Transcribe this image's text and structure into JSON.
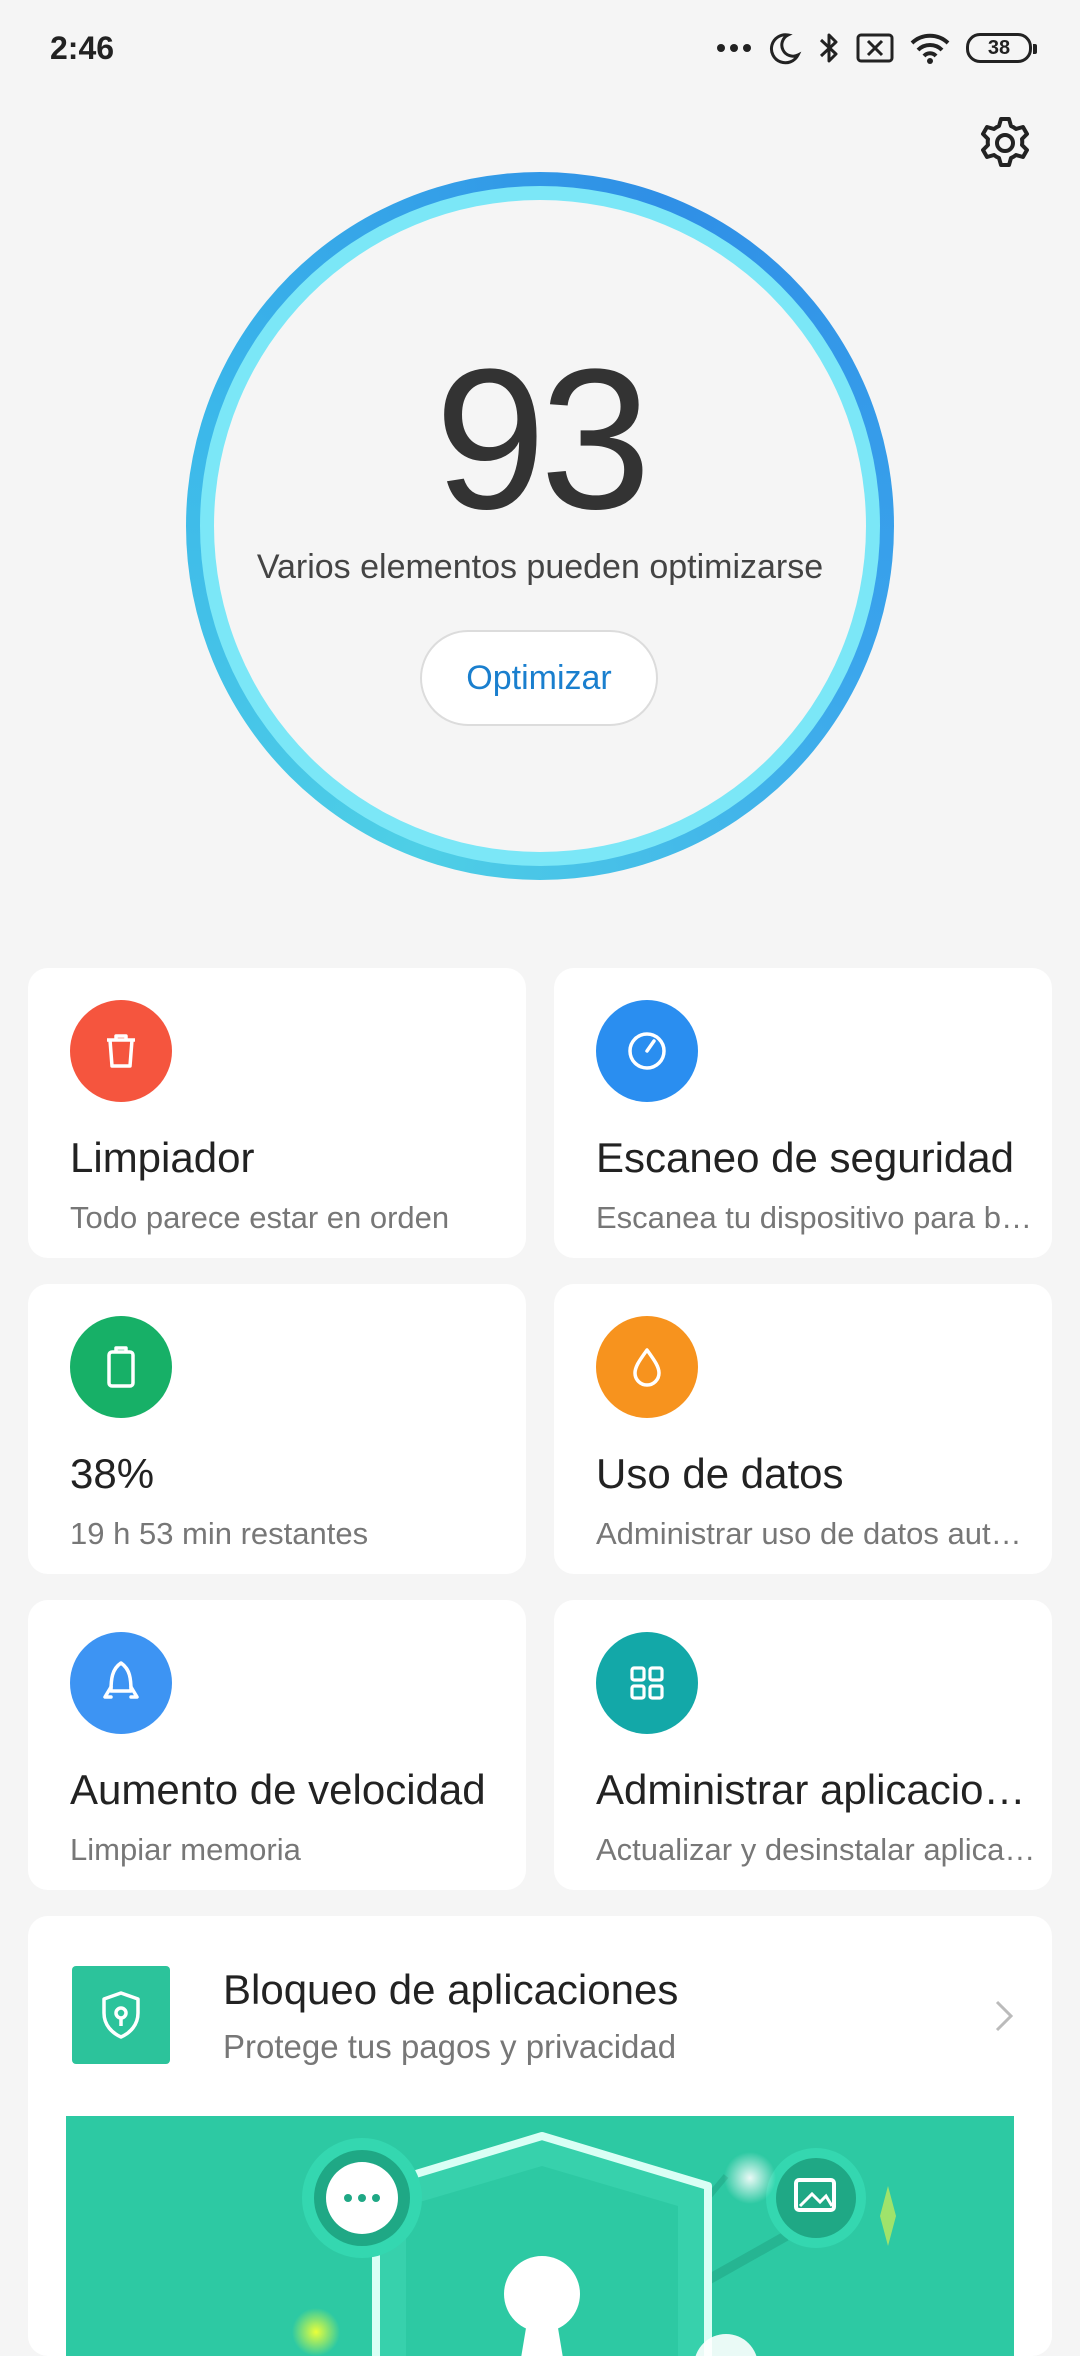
{
  "status_bar": {
    "time": "2:46",
    "battery": "38",
    "icons": [
      "more-dots-icon",
      "moon-icon",
      "bluetooth-icon",
      "sim-x-icon",
      "wifi-icon",
      "battery-icon"
    ]
  },
  "header": {
    "settings_icon": "gear-icon"
  },
  "score": {
    "value": "93",
    "message": "Varios elementos pueden optimizarse",
    "button_label": "Optimizar",
    "ring_colors": [
      "#4ecfe6",
      "#2f8fe6",
      "#7be7f7"
    ]
  },
  "cards": [
    {
      "title": "Limpiador",
      "subtitle": "Todo parece estar en orden",
      "icon": "trash-icon",
      "color": "#f5553e"
    },
    {
      "title": "Escaneo de seguridad",
      "subtitle": "Escanea tu dispositivo para buscar amenazas",
      "icon": "security-scan-icon",
      "color": "#2a8ef0"
    },
    {
      "title": "38%",
      "subtitle": "19 h 53 min  restantes",
      "icon": "battery-icon",
      "color": "#17b067"
    },
    {
      "title": "Uso de datos",
      "subtitle": "Administrar uso de datos automáticamente",
      "icon": "droplet-icon",
      "color": "#f7931e"
    },
    {
      "title": "Aumento de velocidad",
      "subtitle": "Limpiar memoria",
      "icon": "rocket-icon",
      "color": "#3d94f3"
    },
    {
      "title": "Administrar aplicaciones",
      "subtitle": "Actualizar y desinstalar aplicaciones",
      "icon": "apps-grid-icon",
      "color": "#13a8a8"
    }
  ],
  "app_lock": {
    "title": "Bloqueo de aplicaciones",
    "subtitle": "Protege tus pagos y privacidad",
    "icon": "shield-lock-icon",
    "color": "#2cc39b"
  }
}
